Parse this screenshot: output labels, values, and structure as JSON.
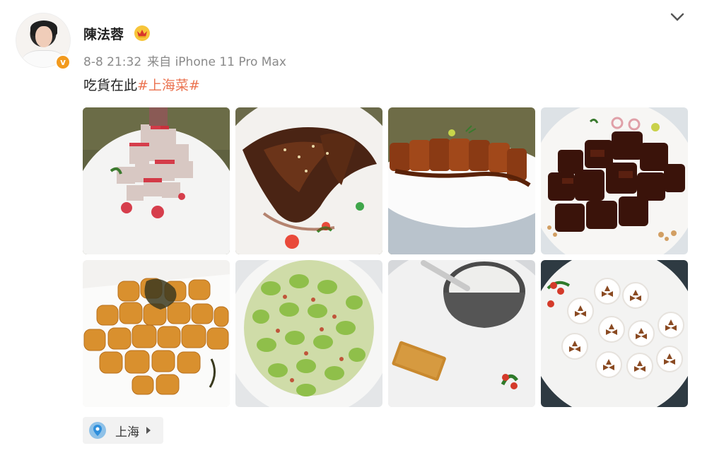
{
  "post": {
    "author": {
      "name": "陳法蓉",
      "verified_icon": "v-badge-icon",
      "member_icon": "crown-icon"
    },
    "meta": {
      "time": "8-8 21:32",
      "source": "来自 iPhone 11 Pro Max"
    },
    "text": {
      "prefix": "吃貨在此",
      "hashtag": "#上海菜#"
    },
    "photos": [
      {
        "name": "photo-tofu-tower"
      },
      {
        "name": "photo-braised-fish"
      },
      {
        "name": "photo-roast-duck"
      },
      {
        "name": "photo-braised-meat"
      },
      {
        "name": "photo-fried-tofu"
      },
      {
        "name": "photo-fava-beans"
      },
      {
        "name": "photo-soup-bowl"
      },
      {
        "name": "photo-flower-rolls"
      }
    ],
    "location": {
      "label": "上海",
      "icon": "location-pin-icon"
    }
  },
  "colors": {
    "hashtag": "#eb7350",
    "meta_gray": "#8a8a8a",
    "verified_orange": "#f29a1e"
  }
}
